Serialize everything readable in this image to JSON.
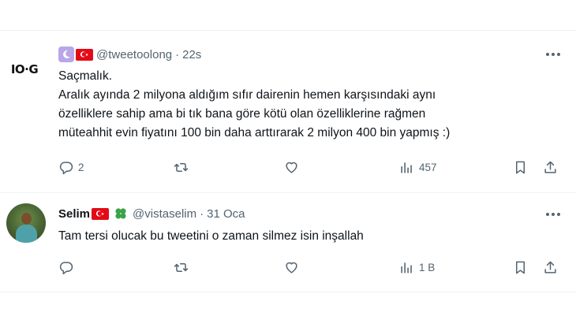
{
  "tweets": [
    {
      "avatar_text": "IO·G",
      "name": "",
      "handle": "@tweetoolong",
      "separator": "·",
      "time": "22s",
      "lines": [
        "Saçmalık.",
        "Aralık ayında 2 milyona aldığım sıfır dairenin hemen karşısındaki aynı",
        "özelliklere sahip ama bi tık bana göre kötü olan özelliklerine rağmen",
        "müteahhit evin fiyatını 100 bin daha arttırarak 2 milyon 400 bin yapmış :)"
      ],
      "reply_count": "2",
      "retweet_count": "",
      "like_count": "",
      "views_count": "457"
    },
    {
      "name": "Selim",
      "handle": "@vistaselim",
      "separator": "·",
      "time": "31 Oca",
      "lines": [
        "Tam tersi olucak bu tweetini o zaman silmez isin inşallah"
      ],
      "reply_count": "",
      "retweet_count": "",
      "like_count": "",
      "views_count": "1 B"
    }
  ],
  "icons": {
    "reply": "reply-icon",
    "retweet": "retweet-icon",
    "like": "heart-icon",
    "views": "views-icon",
    "bookmark": "bookmark-icon",
    "share": "share-icon",
    "more": "more-icon"
  },
  "colors": {
    "text": "#0f1419",
    "secondary": "#536471",
    "divider": "#eff3f4",
    "flag_red": "#e30a17",
    "badge_purple": "#b9a6e8",
    "clover_green": "#3aa34a"
  }
}
